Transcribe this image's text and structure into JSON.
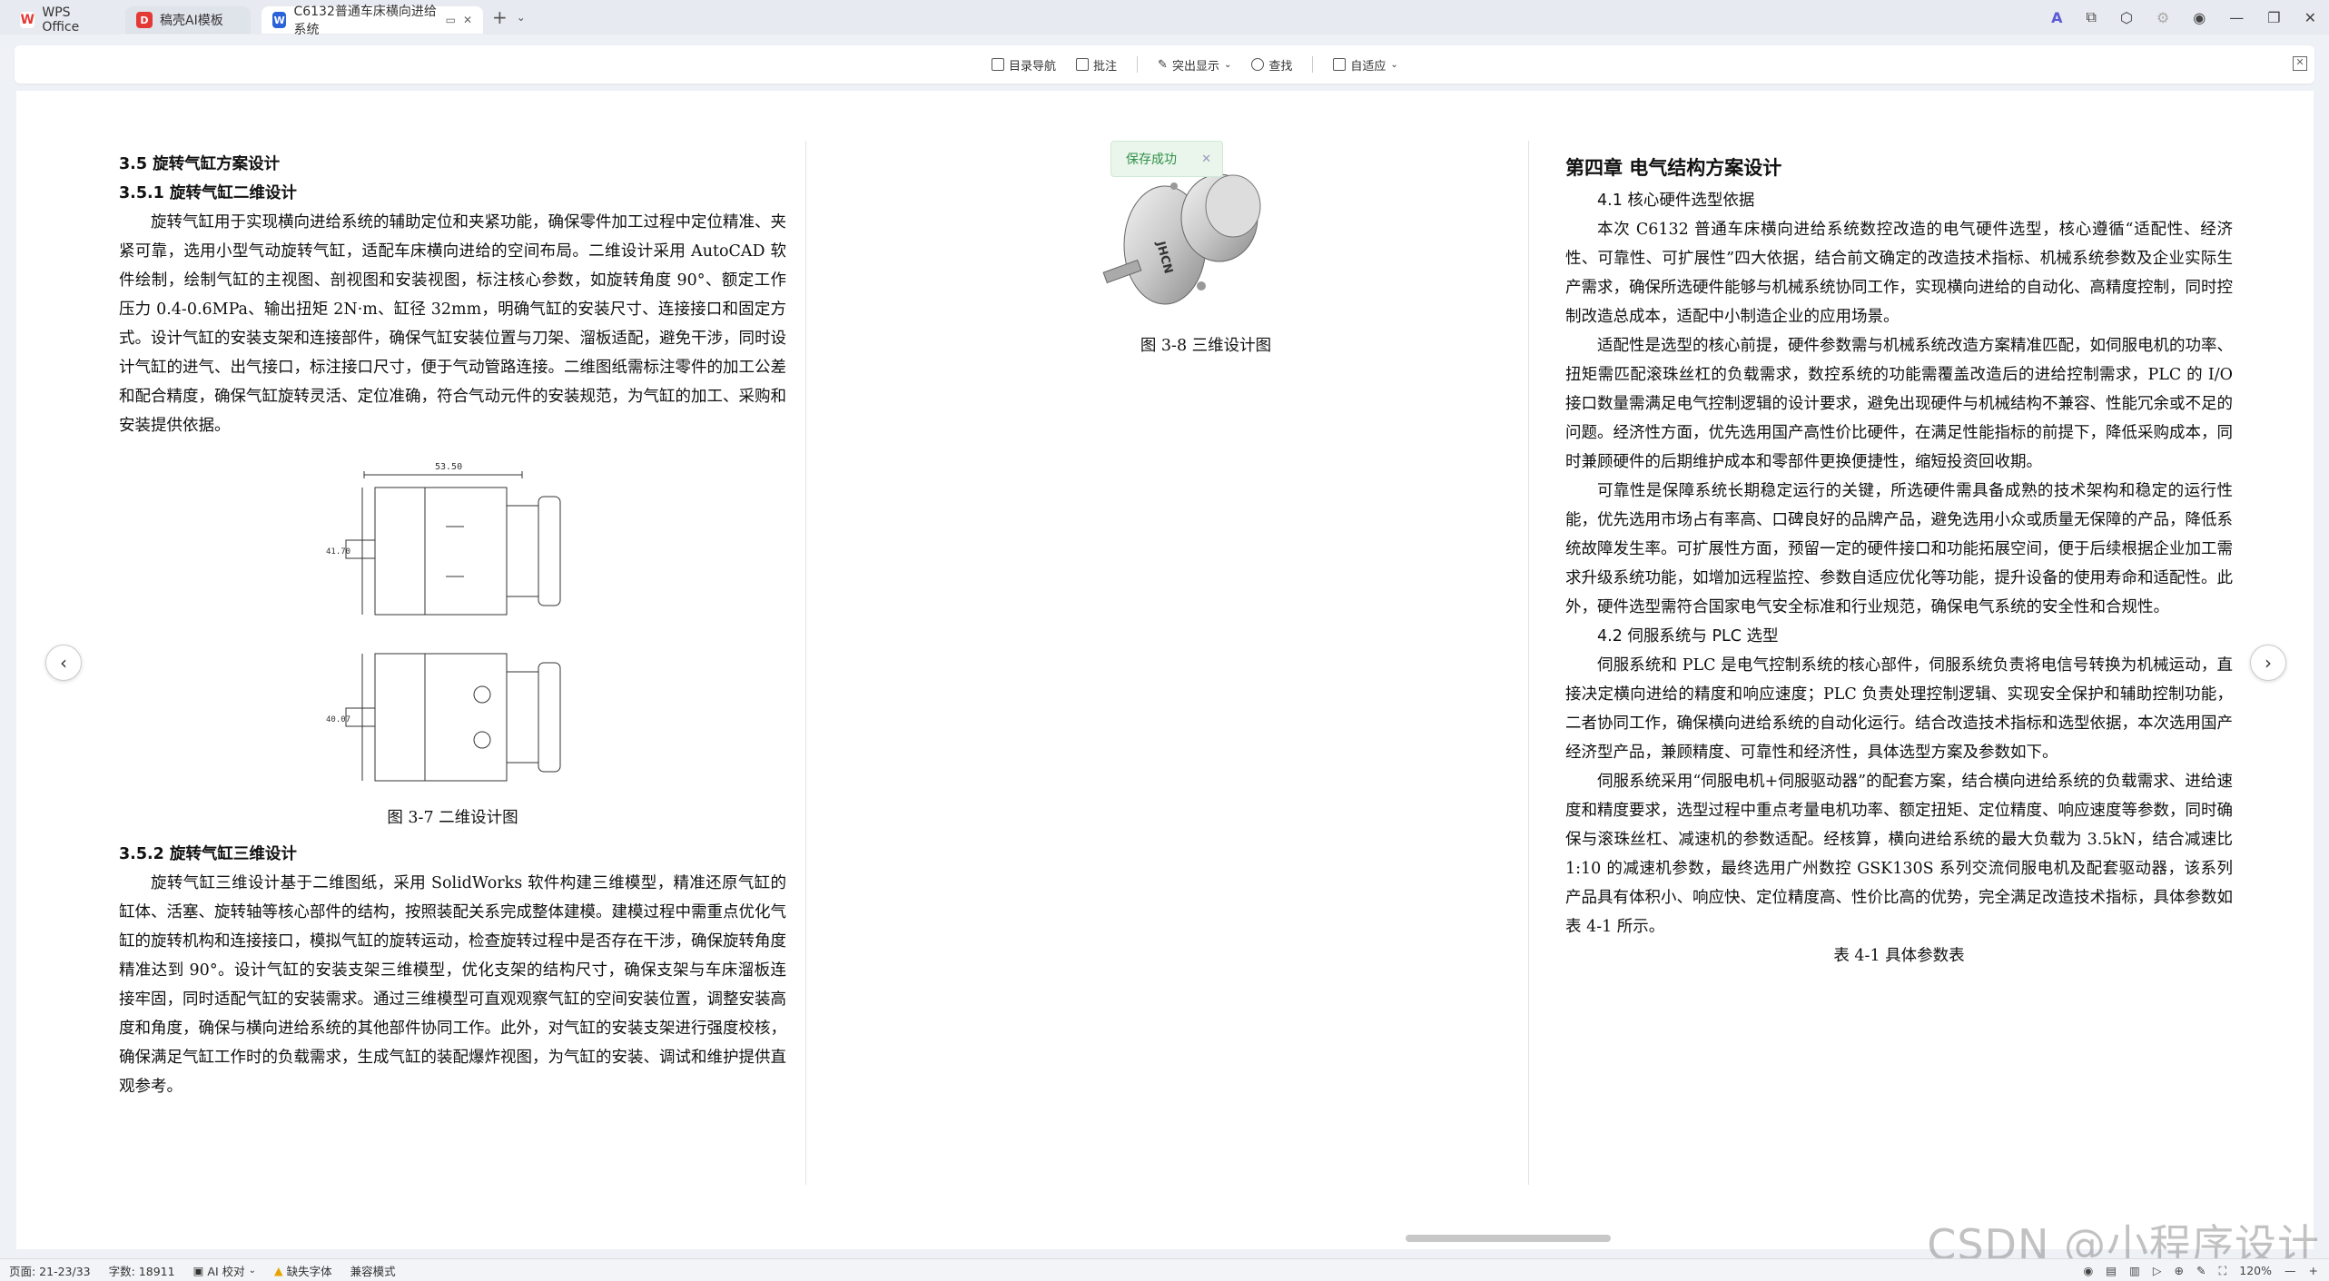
{
  "tabs": [
    {
      "label": "WPS Office",
      "logo": "W"
    },
    {
      "label": "稿壳AI模板",
      "logo": "D"
    },
    {
      "label": "C6132普通车床横向进给系统",
      "logo": "W"
    }
  ],
  "toolbar": {
    "items": [
      "目录导航",
      "批注",
      "突出显示",
      "查找",
      "自适应"
    ]
  },
  "toast": {
    "text": "保存成功"
  },
  "page1": {
    "h_35": "3.5  旋转气缸方案设计",
    "h_351": "3.5.1  旋转气缸二维设计",
    "p1": "旋转气缸用于实现横向进给系统的辅助定位和夹紧功能，确保零件加工过程中定位精准、夹紧可靠，选用小型气动旋转气缸，适配车床横向进给的空间布局。二维设计采用 AutoCAD 软件绘制，绘制气缸的主视图、剖视图和安装视图，标注核心参数，如旋转角度 90°、额定工作压力 0.4-0.6MPa、输出扭矩 2N·m、缸径 32mm，明确气缸的安装尺寸、连接接口和固定方式。设计气缸的安装支架和连接部件，确保气缸安装位置与刀架、溜板适配，避免干涉，同时设计气缸的进气、出气接口，标注接口尺寸，便于气动管路连接。二维图纸需标注零件的加工公差和配合精度，确保气缸旋转灵活、定位准确，符合气动元件的安装规范，为气缸的加工、采购和安装提供依据。",
    "dim_top": "53.50",
    "dim_side1": "41.70",
    "dim_side2": "40.07",
    "fig37": "图 3-7  二维设计图",
    "h_352": "3.5.2  旋转气缸三维设计",
    "p2": "旋转气缸三维设计基于二维图纸，采用 SolidWorks 软件构建三维模型，精准还原气缸的缸体、活塞、旋转轴等核心部件的结构，按照装配关系完成整体建模。建模过程中需重点优化气缸的旋转机构和连接接口，模拟气缸的旋转运动，检查旋转过程中是否存在干涉，确保旋转角度精准达到 90°。设计气缸的安装支架三维模型，优化支架的结构尺寸，确保支架与车床溜板连接牢固，同时适配气缸的安装需求。通过三维模型可直观观察气缸的空间安装位置，调整安装高度和角度，确保与横向进给系统的其他部件协同工作。此外，对气缸的安装支架进行强度校核，确保满足气缸工作时的负载需求，生成气缸的装配爆炸视图，为气缸的安装、调试和维护提供直观参考。"
  },
  "page2": {
    "fig38": "图 3-8  三维设计图",
    "brand": "JHCN"
  },
  "page3": {
    "ch4": "第四章  电气结构方案设计",
    "h_41": "4.1  核心硬件选型依据",
    "p1": "本次 C6132 普通车床横向进给系统数控改造的电气硬件选型，核心遵循“适配性、经济性、可靠性、可扩展性”四大依据，结合前文确定的改造技术指标、机械系统参数及企业实际生产需求，确保所选硬件能够与机械系统协同工作，实现横向进给的自动化、高精度控制，同时控制改造总成本，适配中小制造企业的应用场景。",
    "p2": "适配性是选型的核心前提，硬件参数需与机械系统改造方案精准匹配，如伺服电机的功率、扭矩需匹配滚珠丝杠的负载需求，数控系统的功能需覆盖改造后的进给控制需求，PLC 的 I/O 接口数量需满足电气控制逻辑的设计要求，避免出现硬件与机械结构不兼容、性能冗余或不足的问题。经济性方面，优先选用国产高性价比硬件，在满足性能指标的前提下，降低采购成本，同时兼顾硬件的后期维护成本和零部件更换便捷性，缩短投资回收期。",
    "p3": "可靠性是保障系统长期稳定运行的关键，所选硬件需具备成熟的技术架构和稳定的运行性能，优先选用市场占有率高、口碑良好的品牌产品，避免选用小众或质量无保障的产品，降低系统故障发生率。可扩展性方面，预留一定的硬件接口和功能拓展空间，便于后续根据企业加工需求升级系统功能，如增加远程监控、参数自适应优化等功能，提升设备的使用寿命和适配性。此外，硬件选型需符合国家电气安全标准和行业规范，确保电气系统的安全性和合规性。",
    "h_42": "4.2  伺服系统与 PLC 选型",
    "p4": "伺服系统和 PLC 是电气控制系统的核心部件，伺服系统负责将电信号转换为机械运动，直接决定横向进给的精度和响应速度；PLC 负责处理控制逻辑、实现安全保护和辅助控制功能，二者协同工作，确保横向进给系统的自动化运行。结合改造技术指标和选型依据，本次选用国产经济型产品，兼顾精度、可靠性和经济性，具体选型方案及参数如下。",
    "p5": "伺服系统采用“伺服电机+伺服驱动器”的配套方案，结合横向进给系统的负载需求、进给速度和精度要求，选型过程中重点考量电机功率、额定扭矩、定位精度、响应速度等参数，同时确保与滚珠丝杠、减速机的参数适配。经核算，横向进给系统的最大负载为 3.5kN，结合减速比 1:10 的减速机参数，最终选用广州数控 GSK130S 系列交流伺服电机及配套驱动器，该系列产品具有体积小、响应快、定位精度高、性价比高的优势，完全满足改造技术指标，具体参数如表 4-1 所示。",
    "table41": "表 4-1 具体参数表"
  },
  "statusbar": {
    "page": "页面: 21-23/33",
    "words": "字数: 18911",
    "ai": "AI 校对",
    "font": "缺失字体",
    "mode": "兼容模式",
    "zoom": "120%"
  },
  "watermark": "CSDN @小程序设计"
}
